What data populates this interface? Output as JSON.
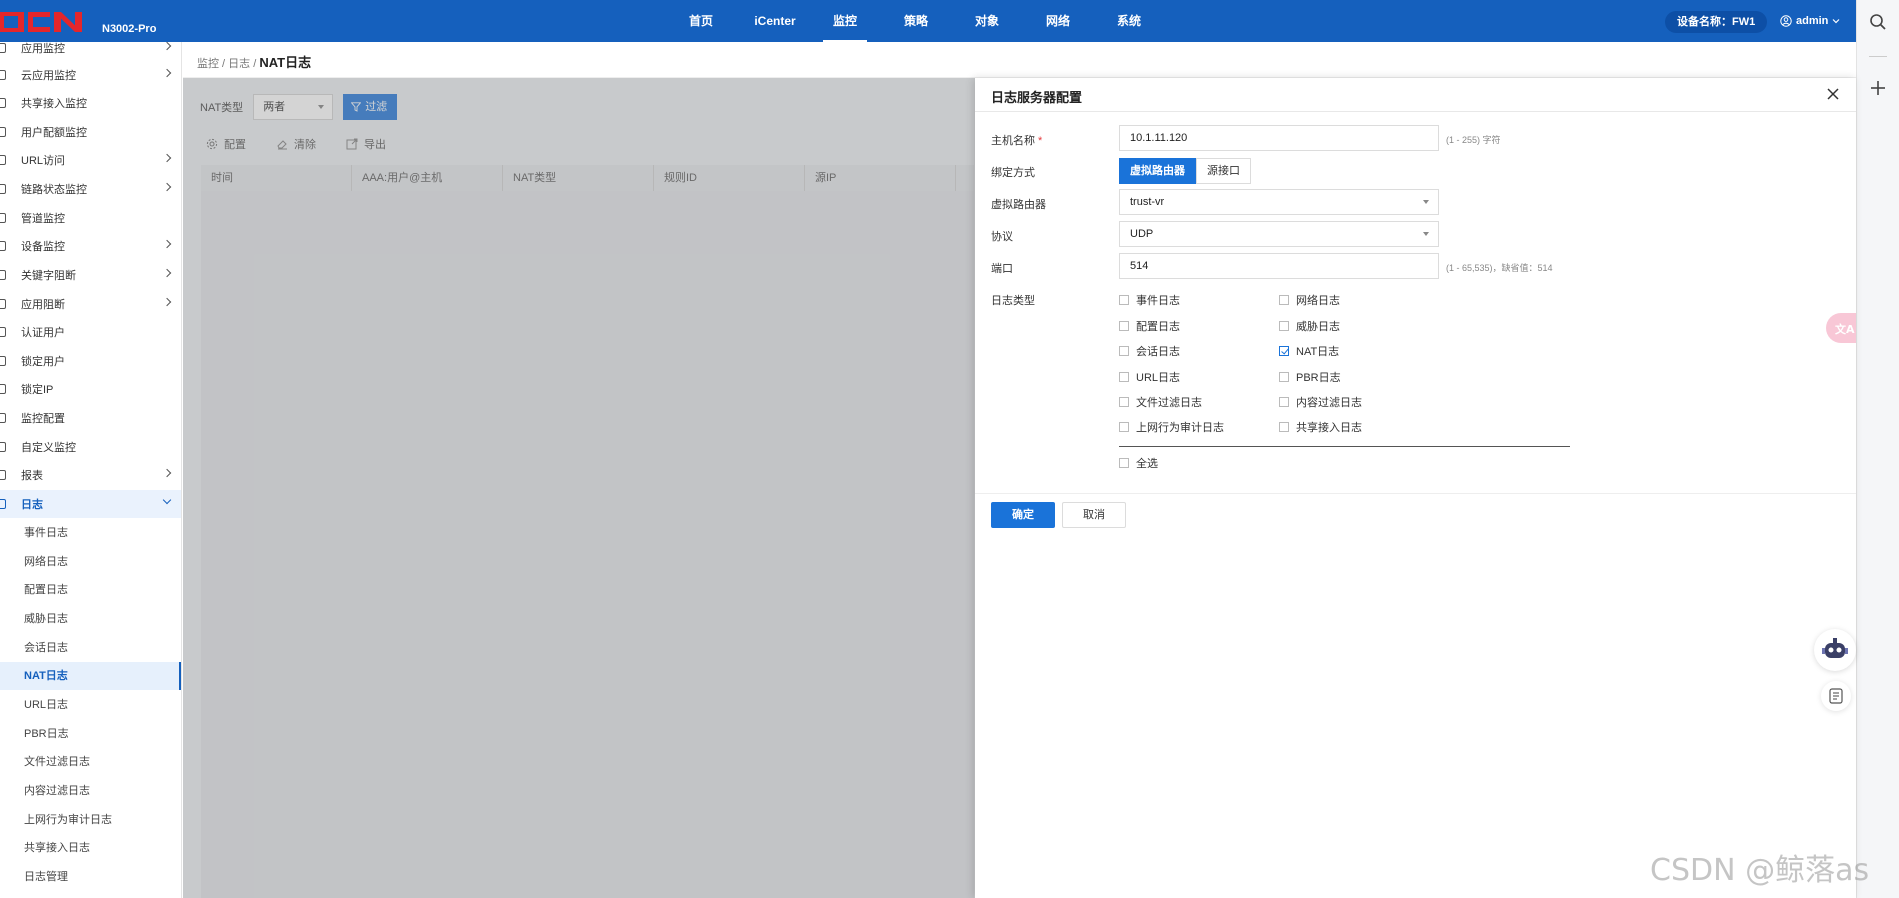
{
  "topbar": {
    "logo_text": "DCN",
    "model": "N3002-Pro",
    "nav": [
      "首页",
      "iCenter",
      "监控",
      "策略",
      "对象",
      "网络",
      "系统"
    ],
    "active_nav": "监控",
    "device_badge": "设备名称：FW1",
    "user": "admin"
  },
  "sidebar": {
    "items": [
      {
        "label": "应用监控",
        "arrow": true
      },
      {
        "label": "云应用监控",
        "arrow": true
      },
      {
        "label": "共享接入监控",
        "arrow": false
      },
      {
        "label": "用户配额监控",
        "arrow": false
      },
      {
        "label": "URL访问",
        "arrow": true
      },
      {
        "label": "链路状态监控",
        "arrow": true
      },
      {
        "label": "管道监控",
        "arrow": false
      },
      {
        "label": "设备监控",
        "arrow": true
      },
      {
        "label": "关键字阻断",
        "arrow": true
      },
      {
        "label": "应用阻断",
        "arrow": true
      },
      {
        "label": "认证用户",
        "arrow": false
      },
      {
        "label": "锁定用户",
        "arrow": false
      },
      {
        "label": "锁定IP",
        "arrow": false
      },
      {
        "label": "监控配置",
        "arrow": false
      },
      {
        "label": "自定义监控",
        "arrow": false
      },
      {
        "label": "报表",
        "arrow": true
      },
      {
        "label": "日志",
        "arrow": true,
        "open": true
      }
    ],
    "log_subitems": [
      "事件日志",
      "网络日志",
      "配置日志",
      "威胁日志",
      "会话日志",
      "NAT日志",
      "URL日志",
      "PBR日志",
      "文件过滤日志",
      "内容过滤日志",
      "上网行为审计日志",
      "共享接入日志",
      "日志管理"
    ],
    "active_subitem": "NAT日志"
  },
  "breadcrumb": {
    "parts": "监控 / 日志 / ",
    "current": "NAT日志"
  },
  "filter": {
    "label": "NAT类型",
    "value": "两者",
    "button": "过滤"
  },
  "toolbar": {
    "config": "配置",
    "clear": "清除",
    "export": "导出"
  },
  "table": {
    "columns": [
      "时间",
      "AAA:用户@主机",
      "NAT类型",
      "规则ID",
      "源IP"
    ]
  },
  "drawer": {
    "title": "日志服务器配置",
    "hostname_label": "主机名称",
    "hostname_value": "10.1.11.120",
    "hostname_hint": "(1 - 255) 字符",
    "bind_label": "绑定方式",
    "bind_options": [
      "虚拟路由器",
      "源接口"
    ],
    "vr_label": "虚拟路由器",
    "vr_value": "trust-vr",
    "protocol_label": "协议",
    "protocol_value": "UDP",
    "port_label": "端口",
    "port_value": "514",
    "port_hint": "(1 - 65,535)，缺省值：514",
    "logtype_label": "日志类型",
    "logtypes": [
      {
        "label": "事件日志",
        "checked": false
      },
      {
        "label": "网络日志",
        "checked": false
      },
      {
        "label": "配置日志",
        "checked": false
      },
      {
        "label": "威胁日志",
        "checked": false
      },
      {
        "label": "会话日志",
        "checked": false
      },
      {
        "label": "NAT日志",
        "checked": true
      },
      {
        "label": "URL日志",
        "checked": false
      },
      {
        "label": "PBR日志",
        "checked": false
      },
      {
        "label": "文件过滤日志",
        "checked": false
      },
      {
        "label": "内容过滤日志",
        "checked": false
      },
      {
        "label": "上网行为审计日志",
        "checked": false
      },
      {
        "label": "共享接入日志",
        "checked": false
      }
    ],
    "select_all": "全选",
    "ok": "确定",
    "cancel": "取消"
  },
  "watermark": "CSDN @鲸落as",
  "colors": {
    "brand": "#1560bd",
    "primary": "#1a73d9",
    "logo_red": "#e4262b"
  }
}
